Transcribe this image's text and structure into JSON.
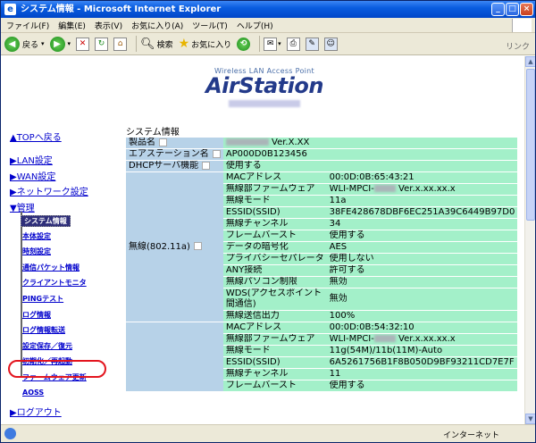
{
  "window": {
    "title": "システム情報 - Microsoft Internet Explorer"
  },
  "menu": [
    "ファイル(F)",
    "編集(E)",
    "表示(V)",
    "お気に入り(A)",
    "ツール(T)",
    "ヘルプ(H)"
  ],
  "toolbar": {
    "back": "戻る",
    "search": "検索",
    "favorites": "お気に入り",
    "links": "リンク"
  },
  "logo": {
    "subtitle": "Wireless LAN Access Point",
    "name": "AirStation"
  },
  "nav": {
    "top": "▲TOPへ戻る",
    "lan": "▶LAN設定",
    "wan": "▶WAN設定",
    "network": "▶ネットワーク設定",
    "admin": "▼管理",
    "subitems": [
      "システム情報",
      "本体設定",
      "時刻設定",
      "通信パケット情報",
      "クライアントモニタ",
      "PINGテスト",
      "ログ情報",
      "ログ情報転送",
      "設定保存／復元",
      "初期化／再起動",
      "ファームウェア更新",
      "AOSS"
    ],
    "logout": "▶ログアウト"
  },
  "content": {
    "title": "システム情報",
    "product_label": "製品名",
    "product_value": "Ver.X.XX",
    "ssid_label": "エアステーション名",
    "ssid_value": "AP000D0B123456",
    "dhcp_label": "DHCPサーバ機能",
    "dhcp_value": "使用する",
    "wireless_label": "無線(802.11a)",
    "wireless_a": [
      {
        "k": "MACアドレス",
        "v": "00:0D:0B:65:43:21"
      },
      {
        "k": "無線部ファームウェア",
        "v": "WLI-MPCI-",
        "v2": "Ver.x.xx.xx.x"
      },
      {
        "k": "無線モード",
        "v": "11a"
      },
      {
        "k": "ESSID(SSID)",
        "v": "38FE428678DBF6EC251A39C6449B97D0"
      },
      {
        "k": "無線チャンネル",
        "v": "34"
      },
      {
        "k": "フレームバースト",
        "v": "使用する"
      },
      {
        "k": "データの暗号化",
        "v": "AES"
      },
      {
        "k": "プライバシーセパレータ",
        "v": "使用しない"
      },
      {
        "k": "ANY接続",
        "v": "許可する"
      },
      {
        "k": "無線パソコン制限",
        "v": "無効"
      },
      {
        "k": "WDS(アクセスポイント間通信)",
        "v": "無効"
      },
      {
        "k": "無線送信出力",
        "v": "100%"
      }
    ],
    "wireless_g": [
      {
        "k": "MACアドレス",
        "v": "00:0D:0B:54:32:10"
      },
      {
        "k": "無線部ファームウェア",
        "v": "WLI-MPCI-",
        "v2": "Ver.x.xx.xx.x"
      },
      {
        "k": "無線モード",
        "v": "11g(54M)/11b(11M)-Auto"
      },
      {
        "k": "ESSID(SSID)",
        "v": "6A5261756B1F8B050D9BF93211CD7E7F"
      },
      {
        "k": "無線チャンネル",
        "v": "11"
      },
      {
        "k": "フレームバースト",
        "v": "使用する"
      }
    ]
  },
  "status": {
    "zone": "インターネット"
  }
}
